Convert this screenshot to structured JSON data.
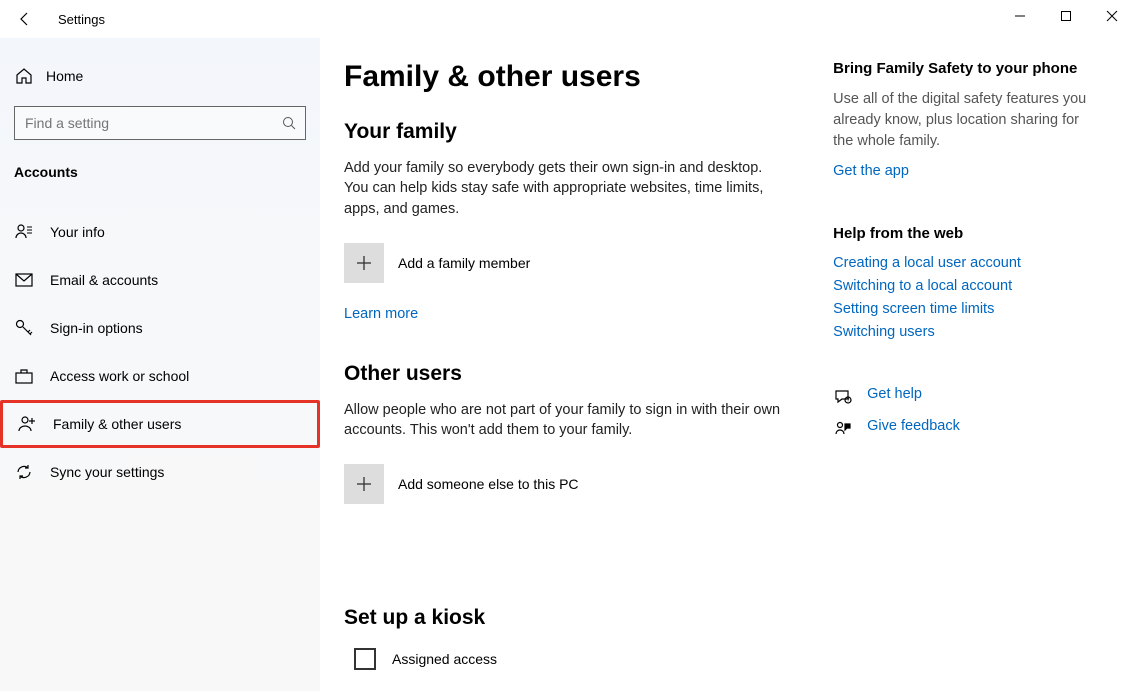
{
  "window": {
    "title": "Settings"
  },
  "sidebar": {
    "home": "Home",
    "search_placeholder": "Find a setting",
    "group": "Accounts",
    "items": [
      {
        "label": "Your info"
      },
      {
        "label": "Email & accounts"
      },
      {
        "label": "Sign-in options"
      },
      {
        "label": "Access work or school"
      },
      {
        "label": "Family & other users"
      },
      {
        "label": "Sync your settings"
      }
    ]
  },
  "main": {
    "title": "Family & other users",
    "family": {
      "heading": "Your family",
      "desc": "Add your family so everybody gets their own sign-in and desktop. You can help kids stay safe with appropriate websites, time limits, apps, and games.",
      "add_label": "Add a family member",
      "learn_more": "Learn more"
    },
    "other": {
      "heading": "Other users",
      "desc": "Allow people who are not part of your family to sign in with their own accounts. This won't add them to your family.",
      "add_label": "Add someone else to this PC"
    },
    "kiosk": {
      "heading": "Set up a kiosk",
      "check_label": "Assigned access"
    }
  },
  "aside": {
    "safety": {
      "heading": "Bring Family Safety to your phone",
      "desc": "Use all of the digital safety features you already know, plus location sharing for the whole family.",
      "link": "Get the app"
    },
    "help": {
      "heading": "Help from the web",
      "links": [
        "Creating a local user account",
        "Switching to a local account",
        "Setting screen time limits",
        "Switching users"
      ]
    },
    "support": {
      "get_help": "Get help",
      "feedback": "Give feedback"
    }
  }
}
